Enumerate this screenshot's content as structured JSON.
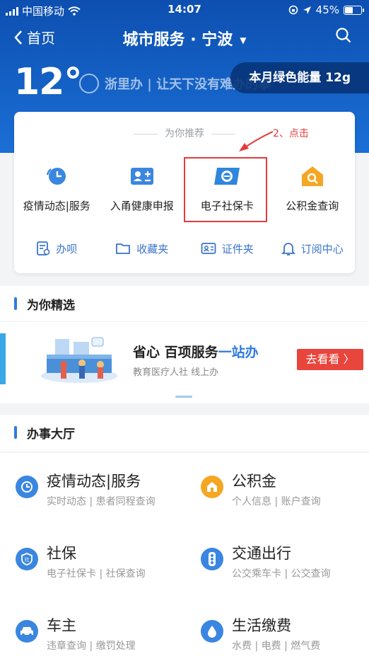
{
  "status_bar": {
    "carrier": "中国移动",
    "time": "14:07",
    "battery": "45%"
  },
  "nav": {
    "back_label": "首页",
    "title": "城市服务 · 宁波"
  },
  "hero": {
    "temperature": "12°",
    "slogan": "浙里办 | 让天下没有难办的事",
    "energy": "本月绿色能量 12g"
  },
  "recommend": {
    "heading": "为你推荐",
    "annotation": "2、点击",
    "items": [
      {
        "label": "疫情动态|服务",
        "icon": "clock-refresh-icon"
      },
      {
        "label": "入甬健康申报",
        "icon": "id-card-plus-icon"
      },
      {
        "label": "电子社保卡",
        "icon": "social-security-card-icon"
      },
      {
        "label": "公积金查询",
        "icon": "house-search-icon"
      }
    ],
    "actions": [
      {
        "label": "办呗",
        "icon": "document-icon"
      },
      {
        "label": "收藏夹",
        "icon": "folder-icon"
      },
      {
        "label": "证件夹",
        "icon": "id-card-icon"
      },
      {
        "label": "订阅中心",
        "icon": "bell-icon"
      }
    ]
  },
  "featured": {
    "title": "为你精选",
    "banner_title_a": "省心 百项服务",
    "banner_title_b": "一站办",
    "banner_sub": "教育医疗人社 线上办",
    "banner_button": "去看看 〉"
  },
  "hall": {
    "title": "办事大厅",
    "services": [
      {
        "name": "疫情动态|服务",
        "sub": "实时动态 | 患者同程查询",
        "icon": "clock-refresh-icon",
        "color": "#3a86e0"
      },
      {
        "name": "公积金",
        "sub": "个人信息 | 账户查询",
        "icon": "house-icon",
        "color": "#f5a623"
      },
      {
        "name": "社保",
        "sub": "电子社保卡 | 社保查询",
        "icon": "shield-icon",
        "color": "#3a86e0"
      },
      {
        "name": "交通出行",
        "sub": "公交乘车卡 | 公交查询",
        "icon": "traffic-light-icon",
        "color": "#3a86e0"
      },
      {
        "name": "车主",
        "sub": "违章查询 | 缴罚处理",
        "icon": "car-icon",
        "color": "#3a86e0"
      },
      {
        "name": "生活缴费",
        "sub": "水费 | 电费 | 燃气费",
        "icon": "water-drop-icon",
        "color": "#3a86e0"
      }
    ]
  }
}
